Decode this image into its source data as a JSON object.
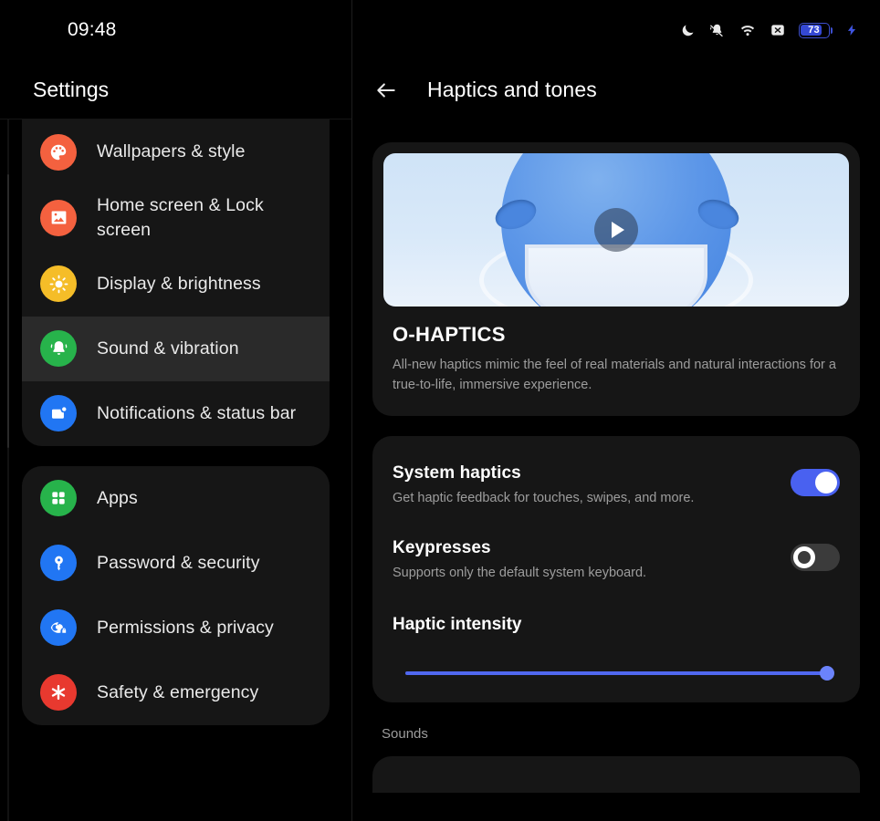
{
  "status_bar": {
    "time": "09:48",
    "icons": [
      "moon-icon",
      "bell-muted-icon",
      "wifi-icon",
      "x-box-icon"
    ],
    "battery_level": "73",
    "battery_charging": true,
    "accent_color": "#3448d4"
  },
  "sidebar": {
    "title": "Settings",
    "groups": [
      {
        "items": [
          {
            "label": "Wallpapers & style",
            "icon": "palette-icon",
            "color": "#f4613f",
            "selected": false
          },
          {
            "label": "Home screen & Lock screen",
            "icon": "image-icon",
            "color": "#f4613f",
            "selected": false
          },
          {
            "label": "Display & brightness",
            "icon": "sun-icon",
            "color": "#f5bd28",
            "selected": false
          },
          {
            "label": "Sound & vibration",
            "icon": "bell-ring-icon",
            "color": "#27b34b",
            "selected": true
          },
          {
            "label": "Notifications & status bar",
            "icon": "notification-card-icon",
            "color": "#2176f3",
            "selected": false
          }
        ]
      },
      {
        "items": [
          {
            "label": "Apps",
            "icon": "grid-icon",
            "color": "#27b34b",
            "selected": false
          },
          {
            "label": "Password & security",
            "icon": "key-icon",
            "color": "#2176f3",
            "selected": false
          },
          {
            "label": "Permissions & privacy",
            "icon": "eye-lock-icon",
            "color": "#2176f3",
            "selected": false
          },
          {
            "label": "Safety & emergency",
            "icon": "asterisk-icon",
            "color": "#e8392f",
            "selected": false
          }
        ]
      }
    ]
  },
  "main": {
    "header": {
      "title": "Haptics and tones",
      "back_icon": "arrow-left-icon"
    },
    "promo": {
      "play_icon": "play-icon",
      "title": "O-HAPTICS",
      "description": "All-new haptics mimic the feel of real materials and natural interactions for a true-to-life, immersive experience."
    },
    "settings": {
      "rows": [
        {
          "title": "System haptics",
          "subtitle": "Get haptic feedback for touches, swipes, and more.",
          "toggle_state": "on"
        },
        {
          "title": "Keypresses",
          "subtitle": "Supports only the default system keyboard.",
          "toggle_state": "off"
        }
      ],
      "slider": {
        "label": "Haptic intensity",
        "value": 100,
        "min": 0,
        "max": 100,
        "track_color": "#5068f0"
      }
    },
    "sounds_section_label": "Sounds"
  }
}
